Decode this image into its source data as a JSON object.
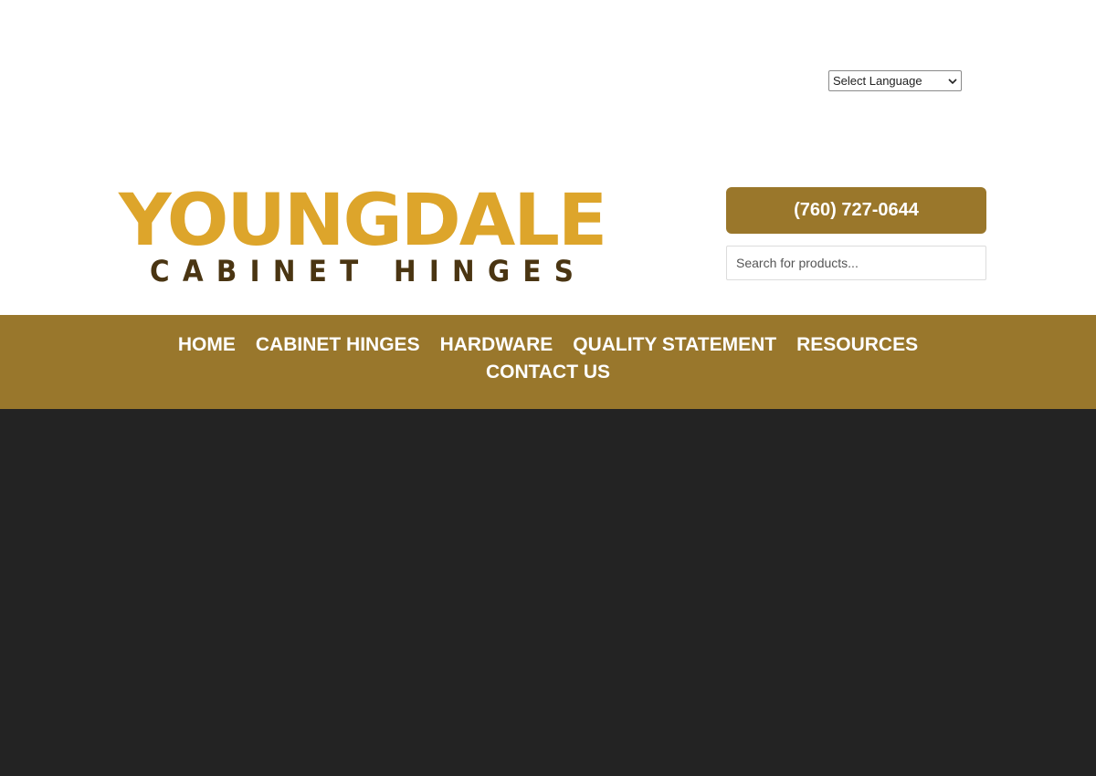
{
  "language": {
    "selected": "Select Language"
  },
  "logo": {
    "main": "YOUNGDALE",
    "sub": "CABINET HINGES"
  },
  "header": {
    "phone_label": "(760) 727-0644",
    "search_placeholder": "Search for products..."
  },
  "nav": {
    "row1": [
      "HOME",
      "CABINET HINGES",
      "HARDWARE",
      "QUALITY STATEMENT",
      "RESOURCES"
    ],
    "row2": [
      "CONTACT US"
    ]
  },
  "colors": {
    "brand_gold": "#DDA52B",
    "brand_brown": "#4A3512",
    "nav_bg": "#99772C",
    "button_bg": "#9A772B",
    "hero_bg": "#232323"
  },
  "icons": {
    "language_dropdown": "chevron-down-icon"
  }
}
